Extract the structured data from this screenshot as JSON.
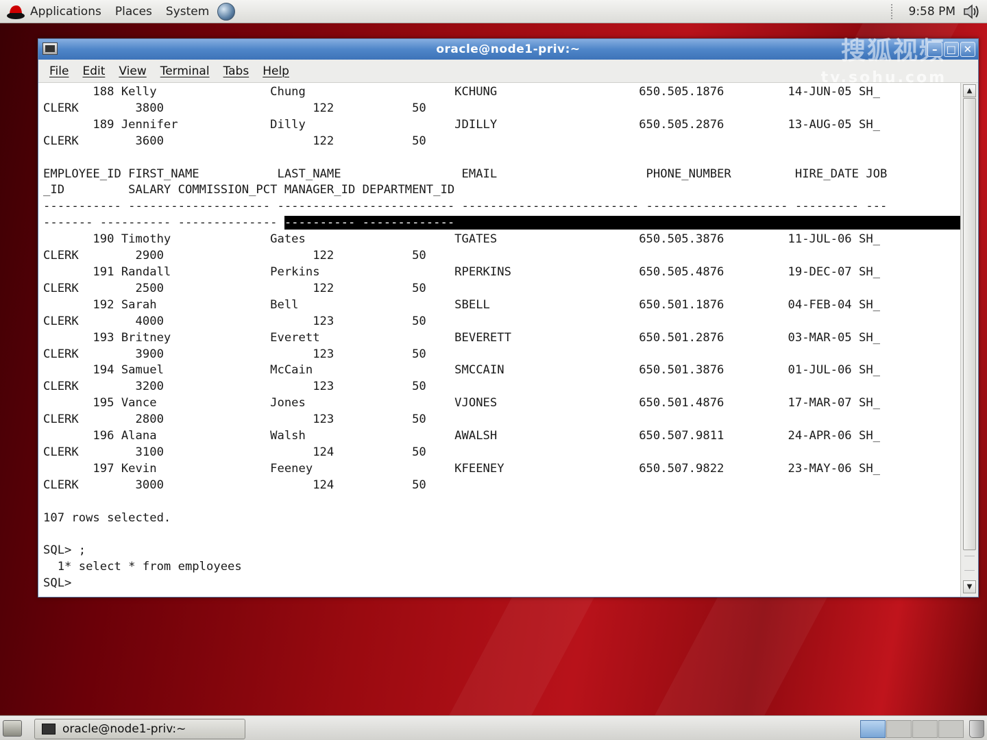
{
  "top_panel": {
    "menus": [
      "Applications",
      "Places",
      "System"
    ],
    "clock": "9:58 PM"
  },
  "window": {
    "title": "oracle@node1-priv:~",
    "watermark": "搜狐视频",
    "watermark_sub": "tv.sohu.com",
    "menubar": [
      "File",
      "Edit",
      "View",
      "Terminal",
      "Tabs",
      "Help"
    ]
  },
  "terminal": {
    "lines_before_highlight": [
      "       188 Kelly                Chung                     KCHUNG                    650.505.1876         14-JUN-05 SH_",
      "CLERK        3800                     122           50",
      "       189 Jennifer             Dilly                     JDILLY                    650.505.2876         13-AUG-05 SH_",
      "CLERK        3600                     122           50",
      "",
      "EMPLOYEE_ID FIRST_NAME           LAST_NAME                 EMAIL                     PHONE_NUMBER         HIRE_DATE JOB",
      "_ID         SALARY COMMISSION_PCT MANAGER_ID DEPARTMENT_ID",
      "----------- -------------------- ------------------------- ------------------------- -------------------- --------- ---"
    ],
    "highlight_row_prefix": "------- ---------- -------------- ",
    "highlight_row_selected": "---------- -------------                                                                          ",
    "lines_after_highlight": [
      "       190 Timothy              Gates                     TGATES                    650.505.3876         11-JUL-06 SH_",
      "CLERK        2900                     122           50",
      "       191 Randall              Perkins                   RPERKINS                  650.505.4876         19-DEC-07 SH_",
      "CLERK        2500                     122           50",
      "       192 Sarah                Bell                      SBELL                     650.501.1876         04-FEB-04 SH_",
      "CLERK        4000                     123           50",
      "       193 Britney              Everett                   BEVERETT                  650.501.2876         03-MAR-05 SH_",
      "CLERK        3900                     123           50",
      "       194 Samuel               McCain                    SMCCAIN                   650.501.3876         01-JUL-06 SH_",
      "CLERK        3200                     123           50",
      "       195 Vance                Jones                     VJONES                    650.501.4876         17-MAR-07 SH_",
      "CLERK        2800                     123           50",
      "       196 Alana                Walsh                     AWALSH                    650.507.9811         24-APR-06 SH_",
      "CLERK        3100                     124           50",
      "       197 Kevin                Feeney                    KFEENEY                   650.507.9822         23-MAY-06 SH_",
      "CLERK        3000                     124           50",
      "",
      "107 rows selected.",
      "",
      "SQL> ;",
      "  1* select * from employees",
      "SQL> "
    ]
  },
  "taskbar": {
    "task_label": "oracle@node1-priv:~"
  }
}
